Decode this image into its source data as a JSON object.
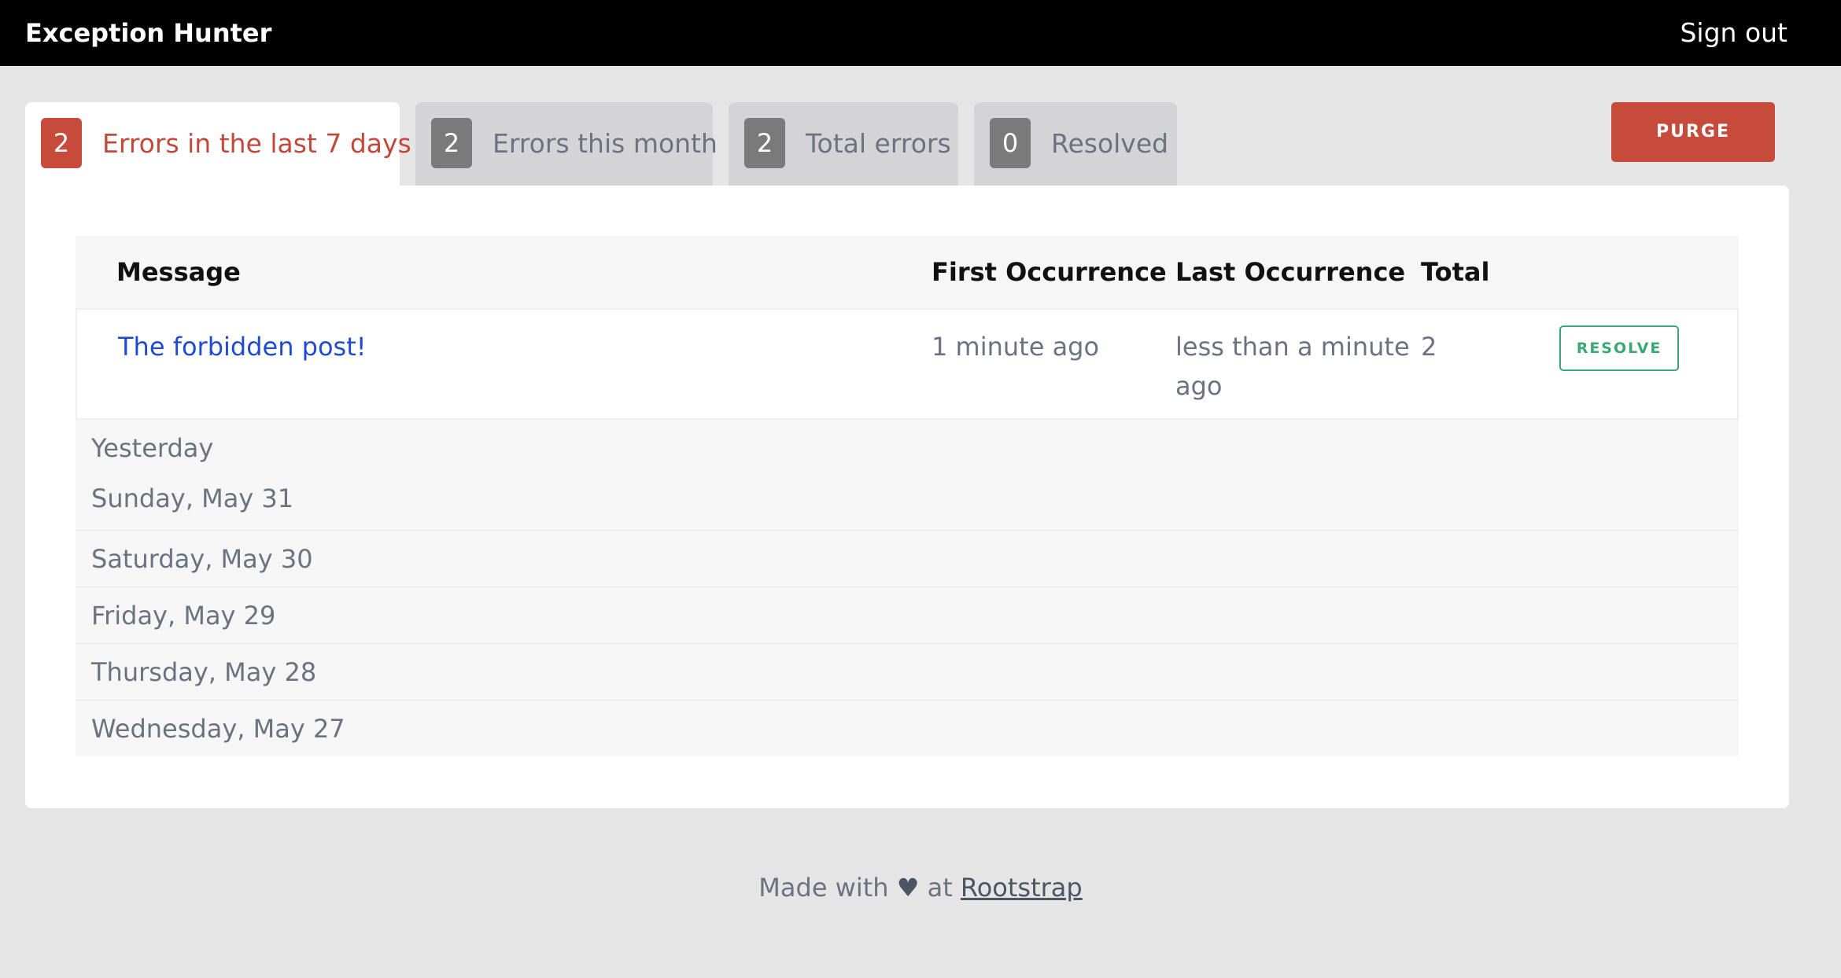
{
  "app": {
    "title": "Exception Hunter",
    "sign_out": "Sign out"
  },
  "tabs": [
    {
      "count": "2",
      "label": "Errors in the last 7 days",
      "active": true
    },
    {
      "count": "2",
      "label": "Errors this month",
      "active": false
    },
    {
      "count": "2",
      "label": "Total errors",
      "active": false
    },
    {
      "count": "0",
      "label": "Resolved",
      "active": false
    }
  ],
  "purge_label": "PURGE",
  "table": {
    "headers": {
      "message": "Message",
      "first": "First Occurrence",
      "last": "Last Occurrence",
      "total": "Total"
    },
    "rows": [
      {
        "message": "The forbidden post!",
        "first": "1 minute ago",
        "last_line1": "less than a minute",
        "last_line2": "ago",
        "total": "2",
        "action": "RESOLVE"
      }
    ],
    "days": [
      "Yesterday",
      "Sunday, May 31",
      "Saturday, May 30",
      "Friday, May 29",
      "Thursday, May 28",
      "Wednesday, May 27"
    ]
  },
  "footer": {
    "made_with": "Made with",
    "heart_icon": "heart-icon",
    "at": "at",
    "link": "Rootstrap"
  },
  "colors": {
    "accent": "#c74b3b",
    "link": "#1f4ccf",
    "resolve": "#3aa876",
    "topbar": "#000000"
  }
}
